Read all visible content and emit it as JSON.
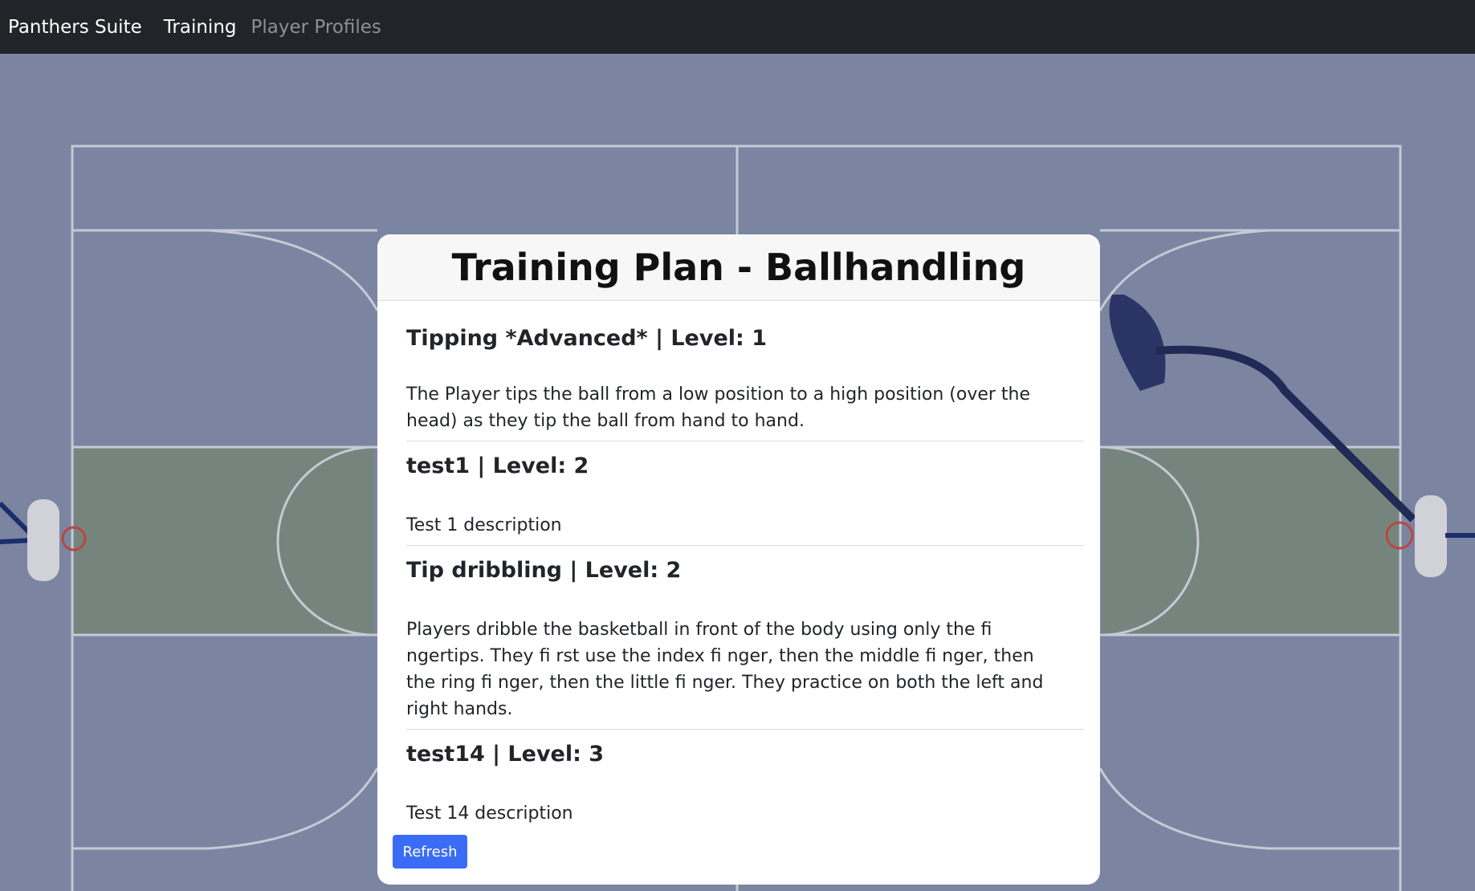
{
  "nav": {
    "brand": "Panthers Suite",
    "links": [
      "Training",
      "Player Profiles"
    ]
  },
  "card": {
    "title": "Training Plan - Ballhandling",
    "items": [
      {
        "title": "Tipping *Advanced* | Level: 1",
        "description": "The Player tips the ball from a low position to a high position (over the head) as they tip the ball from hand to hand."
      },
      {
        "title": "test1 | Level: 2",
        "description": "Test 1 description"
      },
      {
        "title": "Tip dribbling | Level: 2",
        "description": "Players dribble the basketball in front of the body using only the fi ngertips. They fi rst use the index fi nger, then the middle fi nger, then the ring fi nger, then the little fi nger. They practice on both the left and right hands."
      },
      {
        "title": "test14 | Level: 3",
        "description": "Test 14 description"
      }
    ],
    "refresh_label": "Refresh"
  },
  "colors": {
    "navbar": "#212529",
    "court_surface": "#7a84a0",
    "paint_area": "#76847a",
    "accent_button": "#3b6cf6"
  }
}
